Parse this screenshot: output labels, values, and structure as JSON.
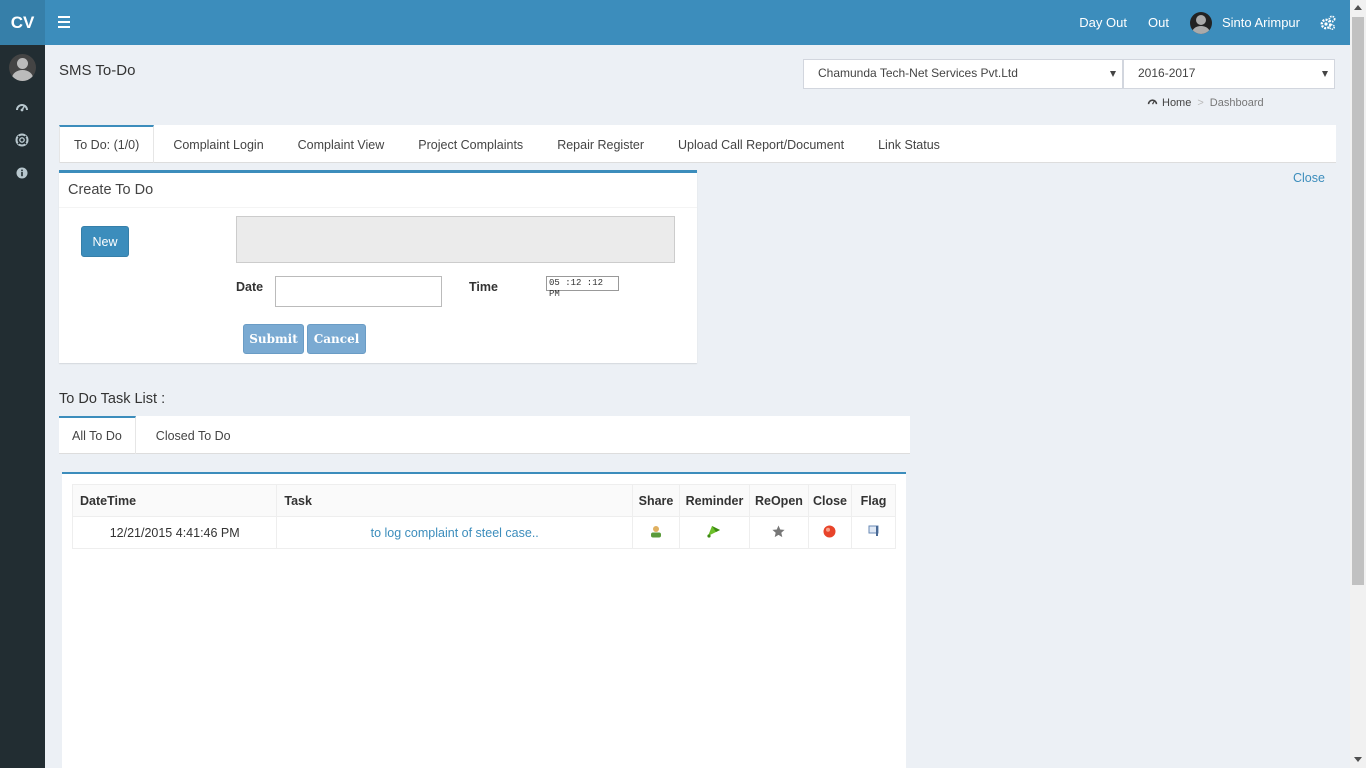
{
  "header": {
    "logo": "CV",
    "day_out": "Day Out",
    "out": "Out",
    "user_name": "Sinto Arimpur"
  },
  "page": {
    "title": "SMS To-Do",
    "company_select": "Chamunda Tech-Net Services Pvt.Ltd",
    "year_select": "2016-2017",
    "breadcrumb": {
      "home": "Home",
      "current": "Dashboard"
    }
  },
  "tabs": [
    {
      "label": "To Do: (1/0)"
    },
    {
      "label": "Complaint Login"
    },
    {
      "label": "Complaint View"
    },
    {
      "label": "Project Complaints"
    },
    {
      "label": "Repair Register"
    },
    {
      "label": "Upload Call Report/Document"
    },
    {
      "label": "Link Status"
    }
  ],
  "close_label": "Close",
  "create_box": {
    "title": "Create To Do",
    "new_label": "New",
    "task_value": "",
    "date_label": "Date",
    "date_value": "",
    "time_label": "Time",
    "time_value": "05 :12 :12  PM",
    "submit_label": "Submit",
    "cancel_label": "Cancel"
  },
  "task_list": {
    "title": "To Do Task List :",
    "subtabs": [
      "All To Do",
      "Closed To Do"
    ],
    "columns": [
      "DateTime",
      "Task",
      "Share",
      "Reminder",
      "ReOpen",
      "Close",
      "Flag"
    ],
    "rows": [
      {
        "datetime": "12/21/2015 4:41:46 PM",
        "task": "to log complaint of steel case.."
      }
    ]
  },
  "colors": {
    "primary": "#3c8dbc",
    "sidebar": "#222d32",
    "background": "#ecf0f5"
  }
}
